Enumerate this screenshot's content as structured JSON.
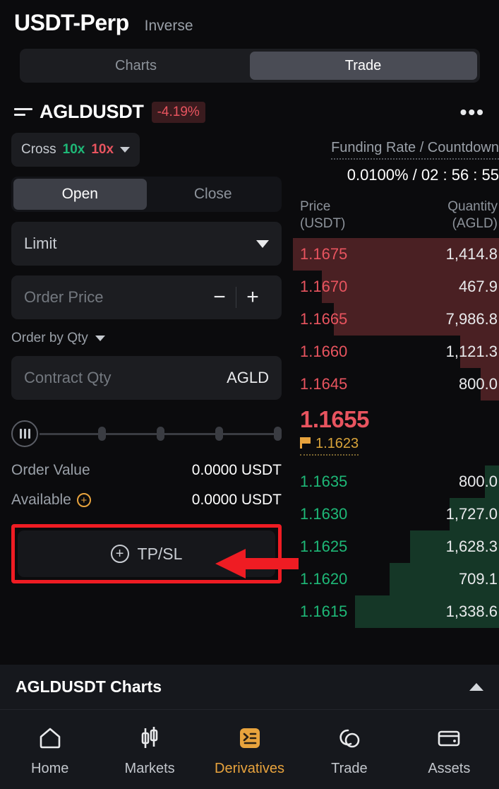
{
  "header": {
    "contract_title": "USDT-Perp",
    "contract_alt": "Inverse",
    "tabs": [
      {
        "label": "Charts",
        "active": false
      },
      {
        "label": "Trade",
        "active": true
      }
    ]
  },
  "symbol": {
    "list_icon": "list-icon",
    "name": "AGLDUSDT",
    "change": "-4.19%",
    "change_color": "#e8545f",
    "more_icon": "more-dots-icon"
  },
  "order_form": {
    "margin_mode": "Cross",
    "leverage_long": "10x",
    "leverage_short": "10x",
    "long_color": "#1eb877",
    "short_color": "#e8545f",
    "side_tabs": [
      {
        "label": "Open",
        "active": true
      },
      {
        "label": "Close",
        "active": false
      }
    ],
    "order_type": "Limit",
    "price_placeholder": "Order Price",
    "minus_label": "−",
    "plus_label": "+",
    "order_by": "Order by Qty",
    "qty_placeholder": "Contract Qty",
    "qty_unit": "AGLD",
    "order_value_label": "Order Value",
    "order_value": "0.0000 USDT",
    "available_label": "Available",
    "available_value": "0.0000 USDT",
    "tpsl_label": "TP/SL",
    "tpsl_plus": "+",
    "highlight_color": "#ef1c23"
  },
  "orderbook": {
    "funding_label": "Funding Rate / Countdown",
    "funding_value": "0.0100% / 02 : 56 : 55",
    "col_price_l1": "Price",
    "col_price_l2": "(USDT)",
    "col_qty_l1": "Quantity",
    "col_qty_l2": "(AGLD)",
    "ask_color": "#e8545f",
    "bid_color": "#1eb877",
    "asks": [
      {
        "price": "1.1675",
        "qty": "1,414.8",
        "depth": 100
      },
      {
        "price": "1.1670",
        "qty": "467.9",
        "depth": 86
      },
      {
        "price": "1.1665",
        "qty": "7,986.8",
        "depth": 80
      },
      {
        "price": "1.1660",
        "qty": "1,121.3",
        "depth": 19
      },
      {
        "price": "1.1645",
        "qty": "800.0",
        "depth": 9
      }
    ],
    "last_price": "1.1655",
    "index_price": "1.1623",
    "bids": [
      {
        "price": "1.1635",
        "qty": "800.0",
        "depth": 7
      },
      {
        "price": "1.1630",
        "qty": "1,727.0",
        "depth": 24
      },
      {
        "price": "1.1625",
        "qty": "1,628.3",
        "depth": 43
      },
      {
        "price": "1.1620",
        "qty": "709.1",
        "depth": 53
      },
      {
        "price": "1.1615",
        "qty": "1,338.6",
        "depth": 70
      }
    ]
  },
  "charts_bar": {
    "title": "AGLDUSDT Charts",
    "collapse_icon": "chevron-up-icon"
  },
  "bottom_nav": {
    "active_color": "#e8a33d",
    "items": [
      {
        "label": "Home",
        "icon": "home-icon",
        "active": false
      },
      {
        "label": "Markets",
        "icon": "candlestick-icon",
        "active": false
      },
      {
        "label": "Derivatives",
        "icon": "derivatives-icon",
        "active": true
      },
      {
        "label": "Trade",
        "icon": "swap-circles-icon",
        "active": false
      },
      {
        "label": "Assets",
        "icon": "wallet-icon",
        "active": false
      }
    ]
  }
}
